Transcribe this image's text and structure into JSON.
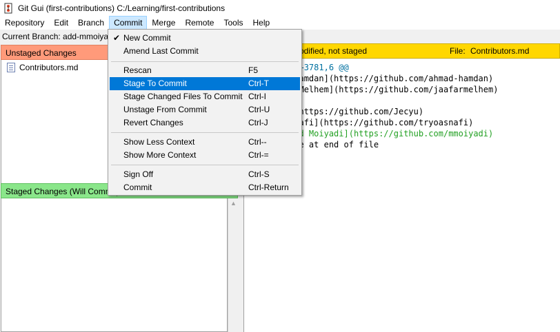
{
  "window": {
    "title": "Git Gui (first-contributions) C:/Learning/first-contributions"
  },
  "menubar": {
    "items": [
      {
        "label": "Repository"
      },
      {
        "label": "Edit"
      },
      {
        "label": "Branch"
      },
      {
        "label": "Commit"
      },
      {
        "label": "Merge"
      },
      {
        "label": "Remote"
      },
      {
        "label": "Tools"
      },
      {
        "label": "Help"
      }
    ]
  },
  "branch": {
    "text": "Current Branch: add-mmoiya"
  },
  "unstaged": {
    "header": "Unstaged Changes",
    "files": [
      {
        "name": "Contributors.md"
      }
    ]
  },
  "staged": {
    "header": "Staged Changes (Will Commit)"
  },
  "diff_header": {
    "status": "Modified, not staged",
    "file_label": "File:",
    "file_name": "Contributors.md"
  },
  "diff_lines": [
    {
      "text": "@@ -3781,5 +3781,6 @@",
      "kind": "hunk"
    },
    {
      "text": " - [Ahmad Hamdan](https://github.com/ahmad-hamdan)",
      "kind": "context"
    },
    {
      "text": " - [Jaafar Melhem](https://github.com/jaafarmelhem)",
      "kind": "context"
    },
    {
      "text": " - [Jecyu](https://github.com/Jecyu)",
      "kind": "context"
    },
    {
      "text": " - [tryoasnafi](https://github.com/tryoasnafi)",
      "kind": "context"
    },
    {
      "text": "+- [Mohammed Moiyadi](https://github.com/mmoiyadi)",
      "kind": "added"
    },
    {
      "text": "\\ No newline at end of file",
      "kind": "context"
    }
  ],
  "commit_menu": {
    "items": [
      {
        "label": "New Commit",
        "accel": "",
        "checked": true
      },
      {
        "label": "Amend Last Commit",
        "accel": ""
      },
      {
        "label": "Rescan",
        "accel": "F5"
      },
      {
        "label": "Stage To Commit",
        "accel": "Ctrl-T"
      },
      {
        "label": "Stage Changed Files To Commit",
        "accel": "Ctrl-I"
      },
      {
        "label": "Unstage From Commit",
        "accel": "Ctrl-U"
      },
      {
        "label": "Revert Changes",
        "accel": "Ctrl-J"
      },
      {
        "label": "Show Less Context",
        "accel": "Ctrl--"
      },
      {
        "label": "Show More Context",
        "accel": "Ctrl-="
      },
      {
        "label": "Sign Off",
        "accel": "Ctrl-S"
      },
      {
        "label": "Commit",
        "accel": "Ctrl-Return"
      }
    ],
    "highlighted": "Stage To Commit"
  },
  "colors": {
    "unstaged_header": "#ff9a7a",
    "staged_header": "#8ae68a",
    "diff_header": "#ffd700",
    "menu_highlight": "#0078d7",
    "hunk": "#0070a0",
    "added": "#22a022"
  },
  "icons": {
    "app": "git-logo-icon",
    "file": "file-icon",
    "check": "check-icon"
  }
}
